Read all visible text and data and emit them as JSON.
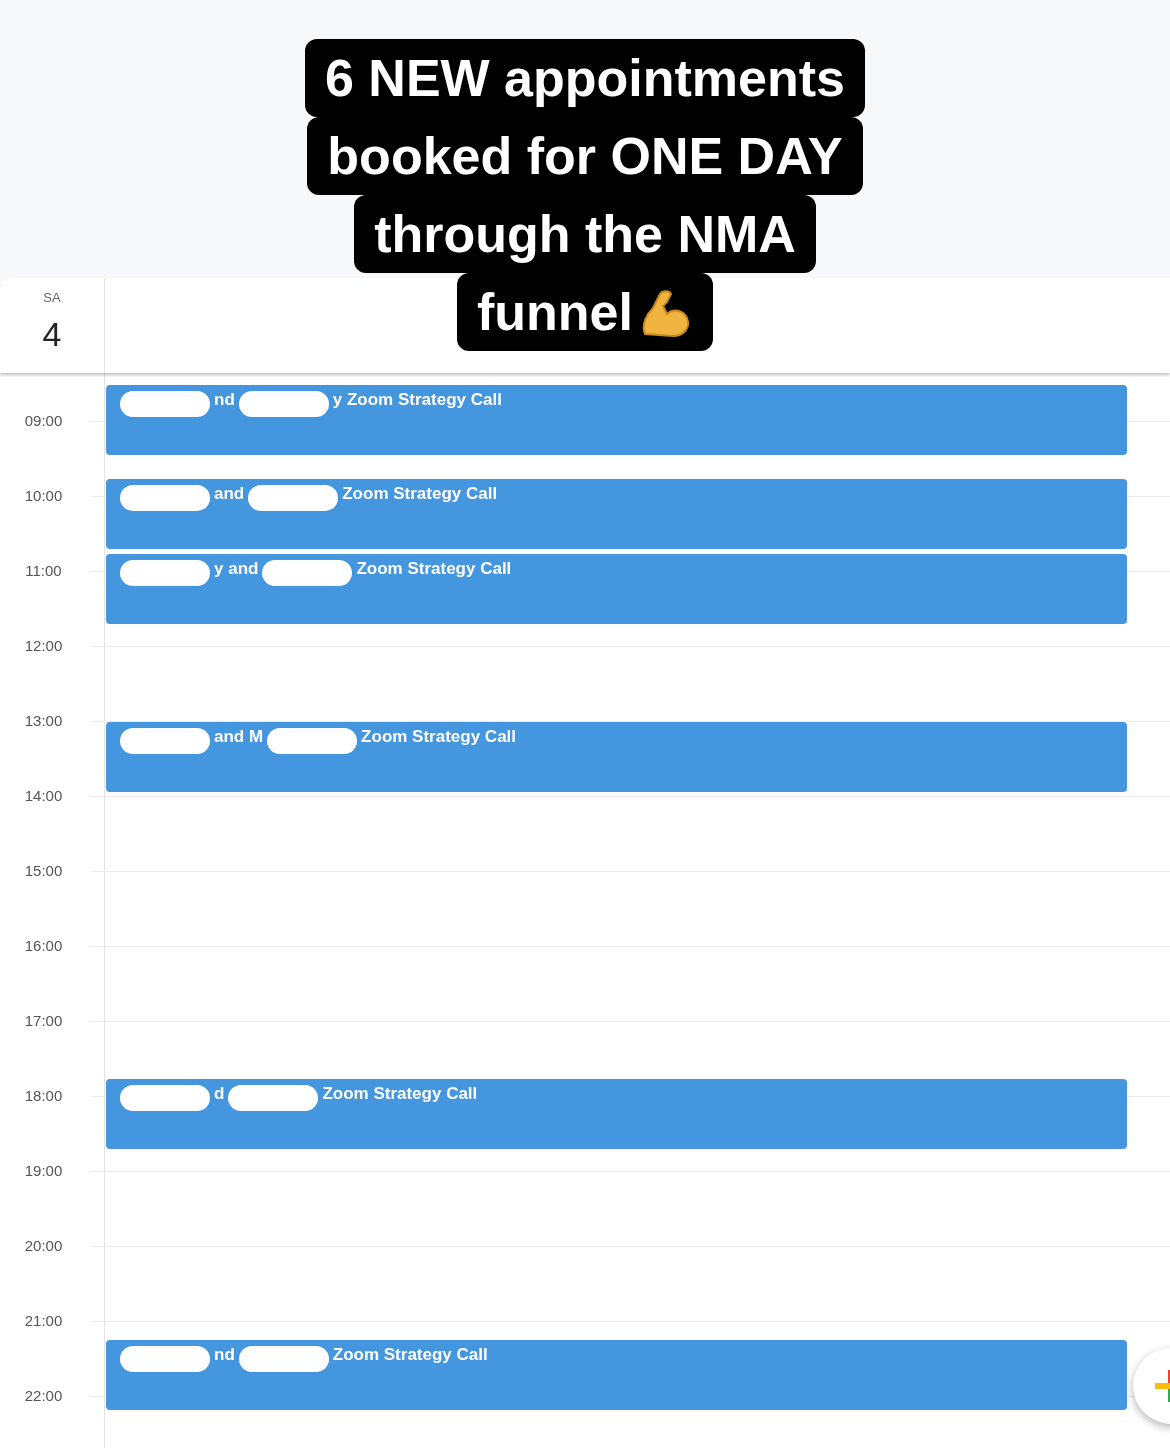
{
  "caption": {
    "lines": [
      "6 NEW appointments",
      "booked for ONE DAY",
      "through the NMA",
      "funnel"
    ]
  },
  "day_header": {
    "weekday": "SA",
    "date": "4"
  },
  "hours": [
    {
      "label": "09:00",
      "events": [
        {
          "segments": [
            {
              "kind": "redaction"
            },
            {
              "kind": "text",
              "text": "nd"
            },
            {
              "kind": "redaction"
            },
            {
              "kind": "text",
              "text": "y Zoom Strategy Call"
            }
          ]
        }
      ]
    },
    {
      "label": "10:00",
      "events": [
        {
          "segments": [
            {
              "kind": "redaction"
            },
            {
              "kind": "text",
              "text": "and"
            },
            {
              "kind": "redaction"
            },
            {
              "kind": "text",
              "text": "Zoom Strategy Call"
            }
          ]
        }
      ]
    },
    {
      "label": "11:00",
      "events": [
        {
          "segments": [
            {
              "kind": "redaction"
            },
            {
              "kind": "text",
              "text": "y and"
            },
            {
              "kind": "redaction"
            },
            {
              "kind": "text",
              "text": "Zoom Strategy Call"
            }
          ]
        }
      ]
    },
    {
      "label": "12:00"
    },
    {
      "label": "13:00",
      "events": [
        {
          "segments": [
            {
              "kind": "redaction"
            },
            {
              "kind": "text",
              "text": "and M"
            },
            {
              "kind": "redaction"
            },
            {
              "kind": "text",
              "text": "Zoom Strategy Call"
            }
          ]
        }
      ]
    },
    {
      "label": "14:00"
    },
    {
      "label": "15:00"
    },
    {
      "label": "16:00"
    },
    {
      "label": "17:00"
    },
    {
      "label": "18:00",
      "events": [
        {
          "segments": [
            {
              "kind": "redaction"
            },
            {
              "kind": "text",
              "text": "d"
            },
            {
              "kind": "redaction"
            },
            {
              "kind": "text",
              "text": "Zoom Strategy Call"
            }
          ]
        }
      ]
    },
    {
      "label": "19:00"
    },
    {
      "label": "20:00"
    },
    {
      "label": "21:00",
      "events": [
        {
          "segments": [
            {
              "kind": "redaction"
            },
            {
              "kind": "text",
              "text": "nd"
            },
            {
              "kind": "redaction"
            },
            {
              "kind": "text",
              "text": "Zoom Strategy Call"
            }
          ]
        }
      ]
    },
    {
      "label": "22:00"
    }
  ]
}
